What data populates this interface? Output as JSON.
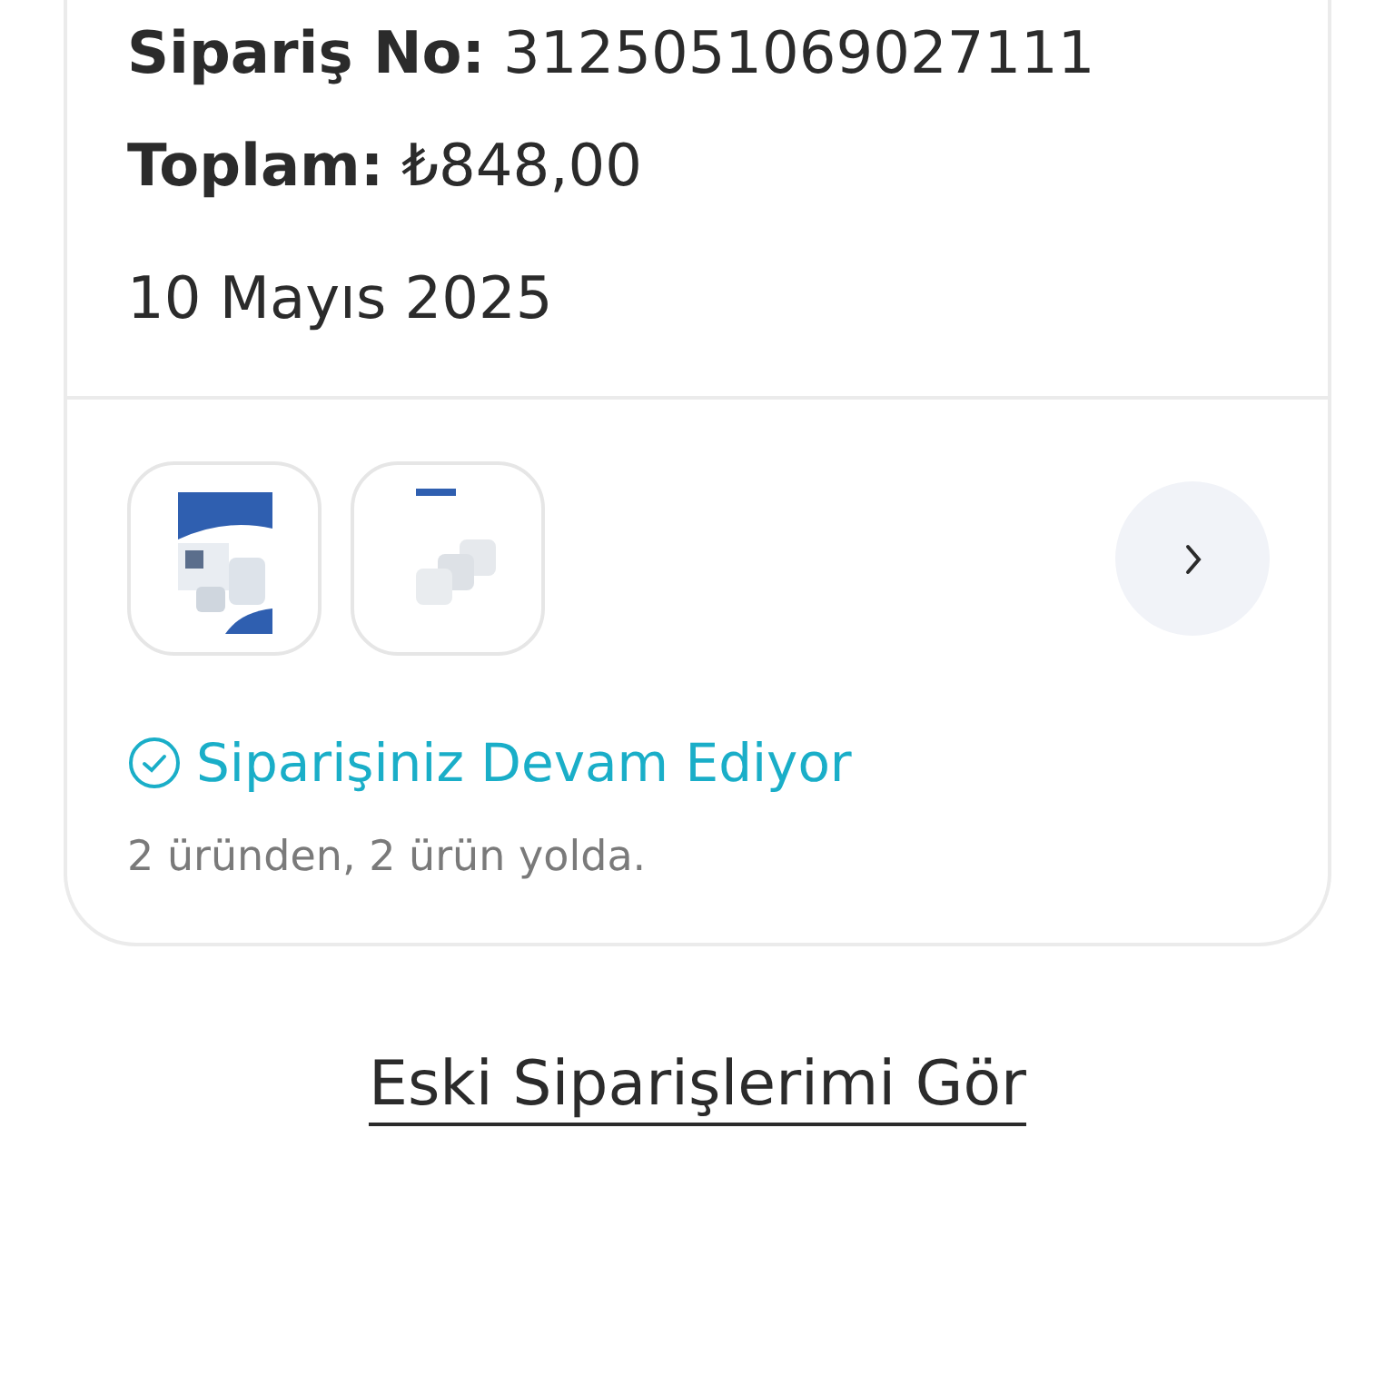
{
  "order": {
    "number_label": "Sipariş No:",
    "number": "3125051069027111",
    "total_label": "Toplam:",
    "total": "₺848,00",
    "date": "10 Mayıs 2025",
    "status": "Siparişiniz Devam Ediyor",
    "summary": "2 üründen, 2 ürün yolda."
  },
  "old_orders_link": "Eski Siparişlerimi Gör"
}
